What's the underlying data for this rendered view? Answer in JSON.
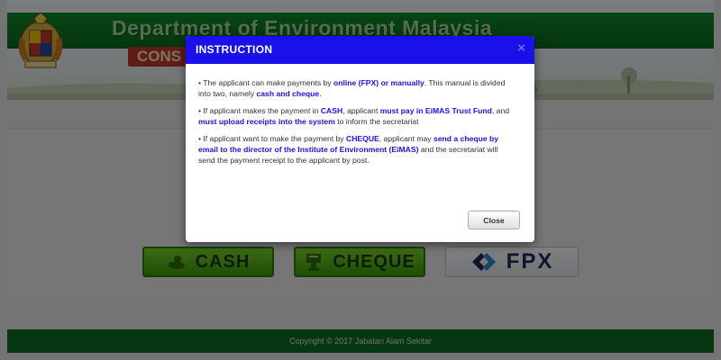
{
  "header": {
    "title": "Department of Environment Malaysia",
    "subtitle_partial": "CONS"
  },
  "payment_buttons": {
    "cash": "CASH",
    "cheque": "CHEQUE",
    "fpx": "FPX"
  },
  "footer": {
    "copyright": "Copyright © 2017 Jabatan Alam Sekitar"
  },
  "modal": {
    "title": "INSTRUCTION",
    "close_x": "×",
    "close_button": "Close",
    "p1": {
      "a": "• The applicant can make payments by ",
      "b": "online (FPX) or manually",
      "c": ". This manual is divided into two, namely ",
      "d": "cash and cheque",
      "e": "."
    },
    "p2": {
      "a": "• If applicant makes the payment in ",
      "b": "CASH",
      "c": ", applicant ",
      "d": "must pay in EiMAS Trust Fund",
      "e": ", and ",
      "f": "must upload receipts into the system",
      "g": " to inform the secretariat"
    },
    "p3": {
      "a": "• If applicant want to make the payment by ",
      "b": "CHEQUE",
      "c": ", applicant may ",
      "d": "send a cheque by email to the director of the Institute of Environment (EiMAS)",
      "e": " and the secretariat will send the payment receipt to the applicant by post."
    }
  },
  "colors": {
    "header_green": "#0f8a2a",
    "modal_header_blue": "#1a11ea",
    "footer_green": "#0c6e24",
    "button_green": "#5bb81c"
  },
  "icons": [
    "crest-logo",
    "cash-icon",
    "cheque-icon",
    "fpx-logo-icon",
    "close-icon"
  ]
}
